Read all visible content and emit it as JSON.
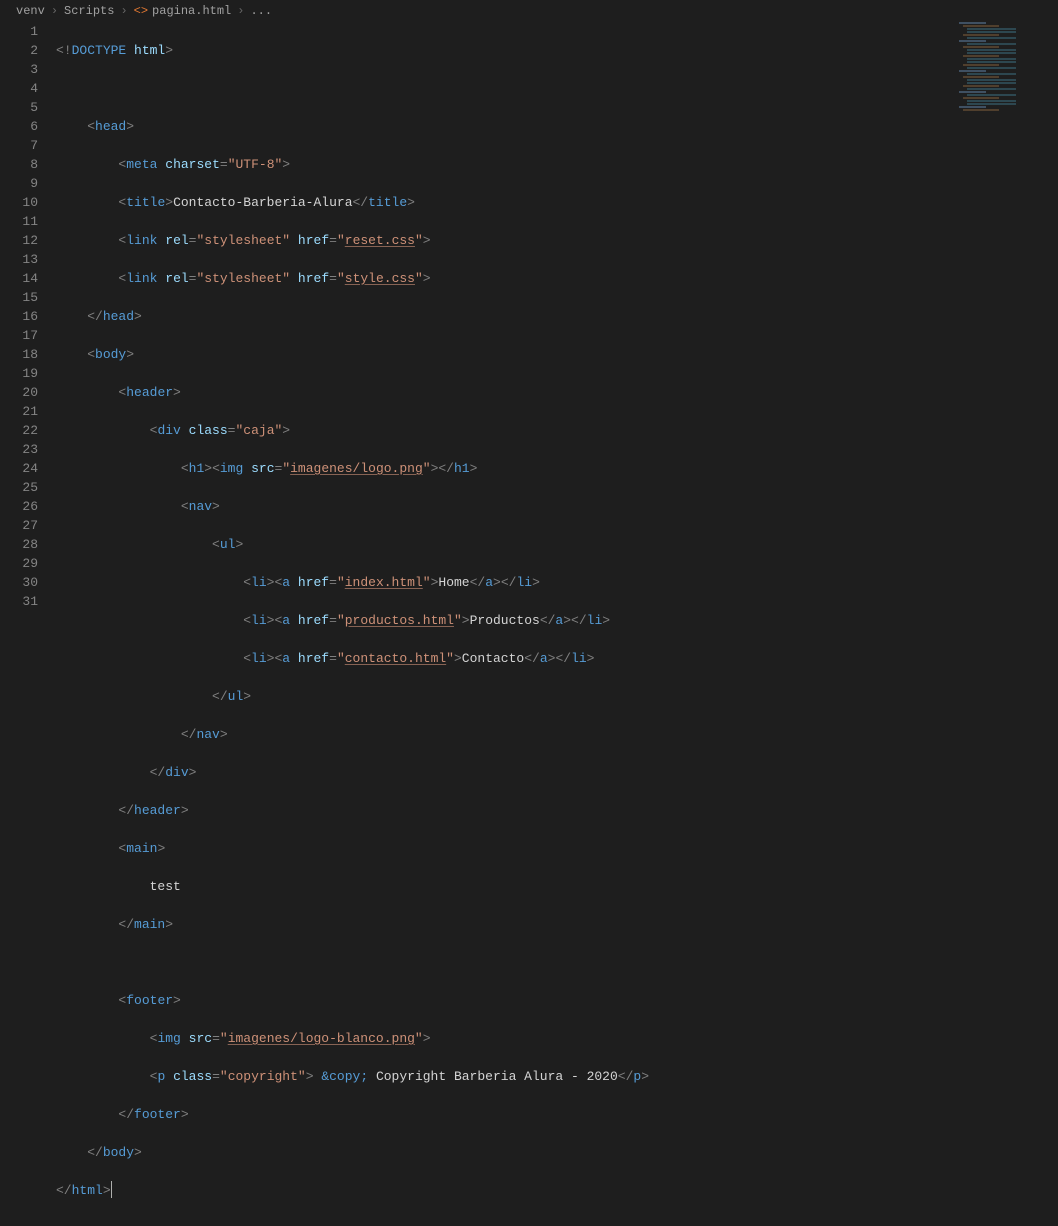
{
  "breadcrumb": {
    "items": [
      "venv",
      "Scripts",
      "pagina.html",
      "..."
    ],
    "file_icon": "<>"
  },
  "lines": {
    "count": 31,
    "numbers": [
      "1",
      "2",
      "3",
      "4",
      "5",
      "6",
      "7",
      "8",
      "9",
      "10",
      "11",
      "12",
      "13",
      "14",
      "15",
      "16",
      "17",
      "18",
      "19",
      "20",
      "21",
      "22",
      "23",
      "24",
      "25",
      "26",
      "27",
      "28",
      "29",
      "30",
      "31"
    ]
  },
  "code": {
    "l1": {
      "doctype_open": "<!",
      "doctype_kw": "DOCTYPE",
      "space": " ",
      "html_kw": "html",
      "close": ">"
    },
    "l3": {
      "open": "<",
      "tag": "head",
      "close": ">"
    },
    "l4": {
      "open": "<",
      "tag": "meta",
      "attr1": "charset",
      "eq": "=",
      "val1": "\"UTF-8\"",
      "close": ">"
    },
    "l5": {
      "open": "<",
      "tag": "title",
      "close": ">",
      "text": "Contacto-Barberia-Alura",
      "open2": "</",
      "tag2": "title",
      "close2": ">"
    },
    "l6": {
      "open": "<",
      "tag": "link",
      "attr1": "rel",
      "val1": "\"stylesheet\"",
      "attr2": "href",
      "val2": "\"reset.css\"",
      "close": ">"
    },
    "l7": {
      "open": "<",
      "tag": "link",
      "attr1": "rel",
      "val1": "\"stylesheet\"",
      "attr2": "href",
      "val2": "\"style.css\"",
      "close": ">"
    },
    "l8": {
      "open": "</",
      "tag": "head",
      "close": ">"
    },
    "l9": {
      "open": "<",
      "tag": "body",
      "close": ">"
    },
    "l10": {
      "open": "<",
      "tag": "header",
      "close": ">"
    },
    "l11": {
      "open": "<",
      "tag": "div",
      "attr1": "class",
      "val1": "\"caja\"",
      "close": ">"
    },
    "l12": {
      "open": "<",
      "tag": "h1",
      "close": ">",
      "open2": "<",
      "tag2": "img",
      "attr1": "src",
      "val1": "\"imagenes/logo.png\"",
      "close2": ">",
      "open3": "</",
      "tag3": "h1",
      "close3": ">"
    },
    "l13": {
      "open": "<",
      "tag": "nav",
      "close": ">"
    },
    "l14": {
      "open": "<",
      "tag": "ul",
      "close": ">"
    },
    "l15": {
      "open": "<",
      "tag": "li",
      "close": ">",
      "open2": "<",
      "tag2": "a",
      "attr1": "href",
      "val1": "\"index.html\"",
      "close2": ">",
      "text": "Home",
      "open3": "</",
      "tag3": "a",
      "close3": ">",
      "open4": "</",
      "tag4": "li",
      "close4": ">"
    },
    "l16": {
      "open": "<",
      "tag": "li",
      "close": ">",
      "open2": "<",
      "tag2": "a",
      "attr1": "href",
      "val1": "\"productos.html\"",
      "close2": ">",
      "text": "Productos",
      "open3": "</",
      "tag3": "a",
      "close3": ">",
      "open4": "</",
      "tag4": "li",
      "close4": ">"
    },
    "l17": {
      "open": "<",
      "tag": "li",
      "close": ">",
      "open2": "<",
      "tag2": "a",
      "attr1": "href",
      "val1": "\"contacto.html\"",
      "close2": ">",
      "text": "Contacto",
      "open3": "</",
      "tag3": "a",
      "close3": ">",
      "open4": "</",
      "tag4": "li",
      "close4": ">"
    },
    "l18": {
      "open": "</",
      "tag": "ul",
      "close": ">"
    },
    "l19": {
      "open": "</",
      "tag": "nav",
      "close": ">"
    },
    "l20": {
      "open": "</",
      "tag": "div",
      "close": ">"
    },
    "l21": {
      "open": "</",
      "tag": "header",
      "close": ">"
    },
    "l22": {
      "open": "<",
      "tag": "main",
      "close": ">"
    },
    "l23": {
      "text": "test"
    },
    "l24": {
      "open": "</",
      "tag": "main",
      "close": ">"
    },
    "l26": {
      "open": "<",
      "tag": "footer",
      "close": ">"
    },
    "l27": {
      "open": "<",
      "tag": "img",
      "attr1": "src",
      "val1": "\"imagenes/logo-blanco.png\"",
      "close": ">"
    },
    "l28": {
      "open": "<",
      "tag": "p",
      "attr1": "class",
      "val1": "\"copyright\"",
      "close": ">",
      "entity": " &copy;",
      "text": " Copyright Barberia Alura - 2020",
      "open2": "</",
      "tag2": "p",
      "close2": ">"
    },
    "l29": {
      "open": "</",
      "tag": "footer",
      "close": ">"
    },
    "l30": {
      "open": "</",
      "tag": "body",
      "close": ">"
    },
    "l31": {
      "open": "</",
      "tag": "html",
      "close": ">"
    }
  }
}
